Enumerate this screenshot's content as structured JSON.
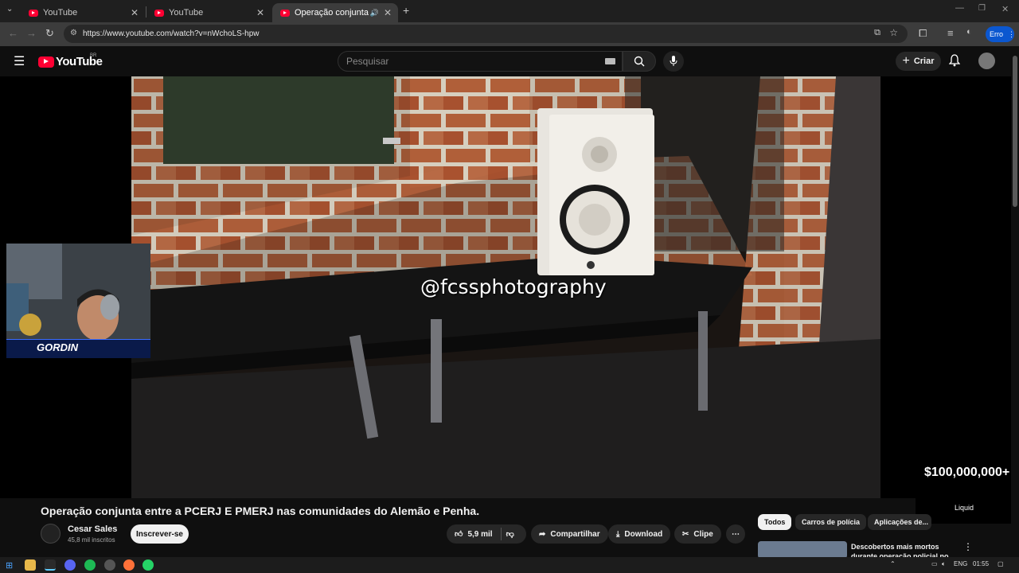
{
  "browser": {
    "tabs": [
      {
        "title": "YouTube",
        "active": false
      },
      {
        "title": "YouTube",
        "active": false
      },
      {
        "title": "Operação conjunta entre a",
        "active": true
      }
    ],
    "url": "https://www.youtube.com/watch?v=nWchoLS-hpw",
    "profile_label": "Erro"
  },
  "youtube": {
    "logo_text": "YouTube",
    "country_code": "BR",
    "search_placeholder": "Pesquisar",
    "create_label": "Criar"
  },
  "video": {
    "watermark": "@fcssphotography",
    "title": "Operação conjunta entre a PCERJ E PMERJ nas comunidades do Alemão e Penha."
  },
  "webcam": {
    "streamer_name": "GORDIN"
  },
  "promo": {
    "amount": "$100,000,000+",
    "brand": "Liquid"
  },
  "channel": {
    "name": "Cesar Sales",
    "subscribers": "45,8 mil inscritos",
    "subscribe_label": "Inscrever-se"
  },
  "actions": {
    "likes": "5,9 mil",
    "share": "Compartilhar",
    "download": "Download",
    "clip": "Clipe"
  },
  "filter_chips": [
    "Todos",
    "Carros de polícia",
    "Aplicações de..."
  ],
  "recommendation": {
    "title": "Descobertos mais mortos durante operação policial no"
  },
  "taskbar": {
    "language": "ENG",
    "time": "01:55"
  },
  "colors": {
    "youtube_red": "#ff0033",
    "background": "#0f0f0f",
    "chrome_blue": "#0b57d0"
  }
}
